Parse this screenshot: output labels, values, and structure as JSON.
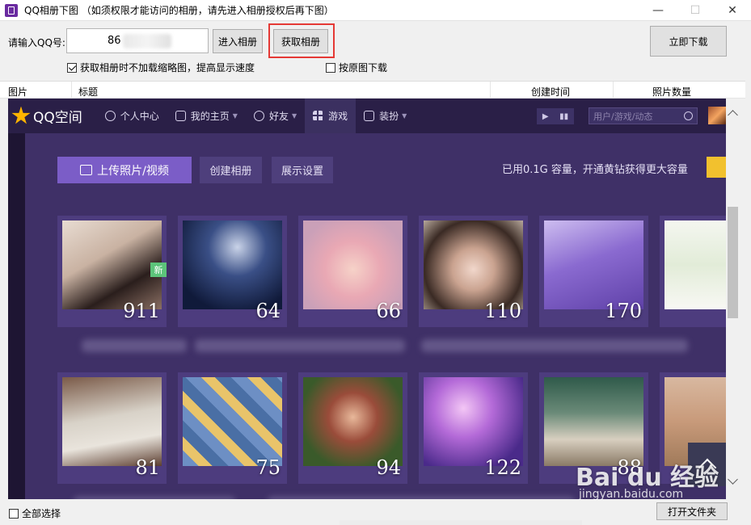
{
  "window": {
    "title": "QQ相册下图 （如须权限才能访问的相册，请先进入相册授权后再下图）",
    "controls": {
      "minimize": "—",
      "maximize": "☐",
      "close": "✕"
    }
  },
  "form": {
    "qq_label": "请输入QQ号:",
    "qq_value": "86",
    "enter_album_label": "进入相册",
    "fetch_album_label": "获取相册",
    "download_now_label": "立即下载",
    "no_thumb_label": "获取相册时不加载缩略图，提高显示速度",
    "no_thumb_checked": true,
    "original_label": "按原图下载",
    "original_checked": false
  },
  "list": {
    "columns": [
      "图片",
      "标题",
      "创建时间",
      "照片数量"
    ]
  },
  "qzone": {
    "logo_text": "QQ空间",
    "nav": [
      {
        "label": "个人中心",
        "icon": "person-icon"
      },
      {
        "label": "我的主页",
        "icon": "home-icon"
      },
      {
        "label": "好友",
        "icon": "friends-icon"
      },
      {
        "label": "游戏",
        "icon": "grid-icon"
      },
      {
        "label": "装扮",
        "icon": "shirt-icon"
      }
    ],
    "search_placeholder": "用户/游戏/动态",
    "upload_label": "上传照片/视频",
    "create_album_label": "创建相册",
    "display_settings_label": "展示设置",
    "storage_text": "已用0.1G 容量，开通黄钻获得更大容量",
    "new_badge": "新",
    "albums_row1": [
      {
        "count": "911"
      },
      {
        "count": "64"
      },
      {
        "count": "66"
      },
      {
        "count": "110"
      },
      {
        "count": "170"
      }
    ],
    "albums_row2": [
      {
        "count": "81"
      },
      {
        "count": "75"
      },
      {
        "count": "94"
      },
      {
        "count": "122"
      },
      {
        "count": "88"
      }
    ],
    "colors": {
      "nav_bg": "#2a1f47",
      "main_bg": "#3f3067",
      "accent": "#7b5dc7"
    }
  },
  "footer": {
    "select_all_label": "全部选择",
    "open_folder_label": "打开文件夹"
  }
}
